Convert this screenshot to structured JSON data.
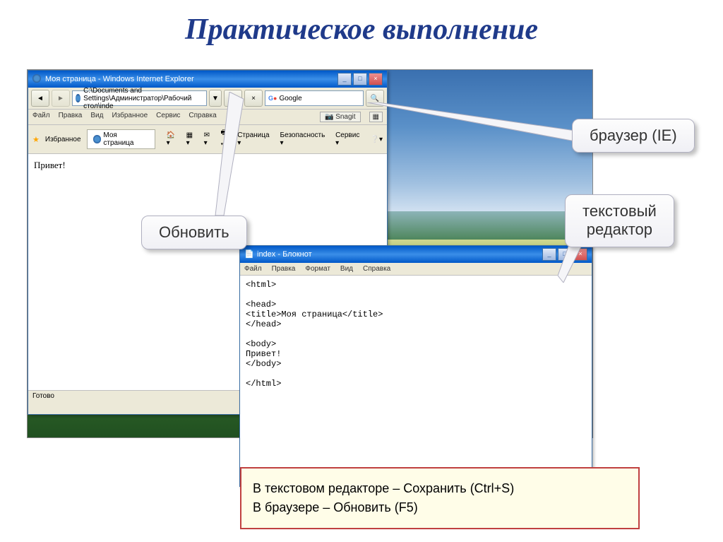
{
  "slide": {
    "title": "Практическое выполнение"
  },
  "ie": {
    "title": "Моя страница - Windows Internet Explorer",
    "address": "C:\\Documents and Settings\\Администратор\\Рабочий стол\\inde",
    "search_engine": "Google",
    "menu": {
      "file": "Файл",
      "edit": "Правка",
      "view": "Вид",
      "favorites": "Избранное",
      "tools": "Сервис",
      "help": "Справка"
    },
    "snagit": "Snagit",
    "fav_label": "Избранное",
    "tab_title": "Моя страница",
    "toolbar": {
      "page": "Страница",
      "security": "Безопасность",
      "service": "Сервис"
    },
    "content": "Привет!",
    "status": "Готово"
  },
  "notepad": {
    "title": "index - Блокнот",
    "menu": {
      "file": "Файл",
      "edit": "Правка",
      "format": "Формат",
      "view": "Вид",
      "help": "Справка"
    },
    "content": "<html>\n\n<head>\n<title>Моя страница</title>\n</head>\n\n<body>\nПривет!\n</body>\n\n</html>"
  },
  "callouts": {
    "refresh": "Обновить",
    "browser": "браузер (IE)",
    "editor": "текстовый\nредактор"
  },
  "tips": {
    "line1": "В текстовом редакторе – Сохранить (Ctrl+S)",
    "line2": "В браузере – Обновить (F5)"
  }
}
